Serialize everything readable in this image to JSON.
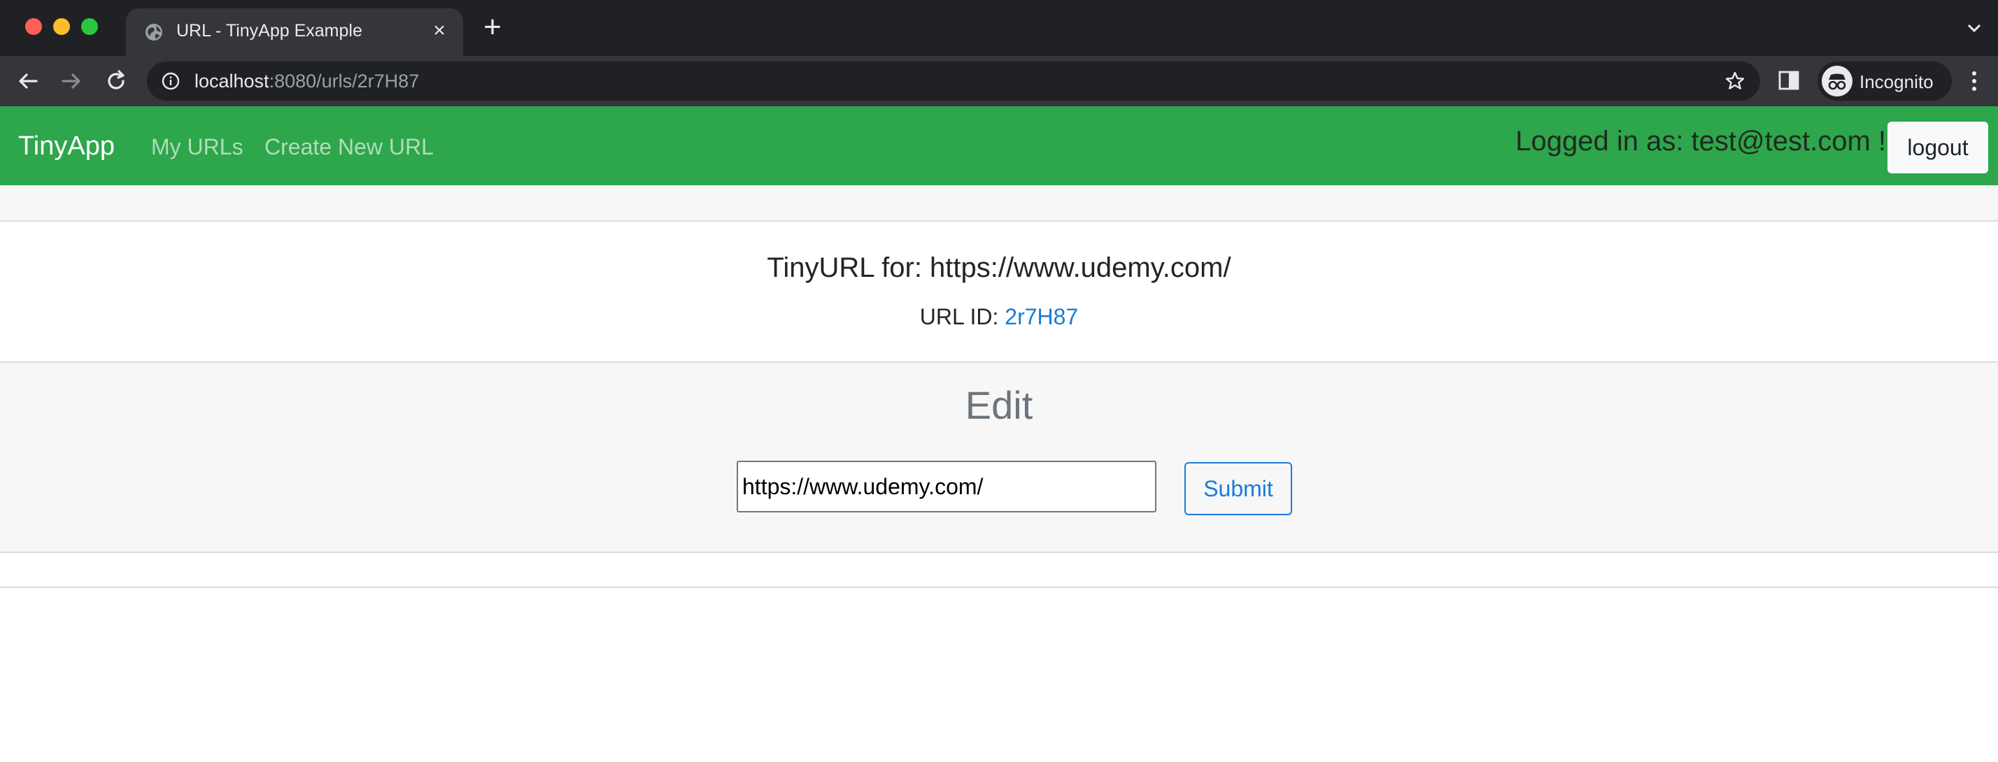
{
  "browser": {
    "tab_title": "URL - TinyApp Example",
    "url_host": "localhost",
    "url_rest": ":8080/urls/2r7H87",
    "profile_label": "Incognito"
  },
  "navbar": {
    "brand": "TinyApp",
    "links": [
      "My URLs",
      "Create New URL"
    ],
    "logged_in_text": "Logged in as: test@test.com !",
    "logout_label": "logout",
    "bg_color": "#2ea64b"
  },
  "url_card": {
    "title": "TinyURL for: https://www.udemy.com/",
    "id_label": "URL ID:",
    "id_value": "2r7H87"
  },
  "edit": {
    "heading": "Edit",
    "input_value": "https://www.udemy.com/",
    "submit_label": "Submit"
  }
}
